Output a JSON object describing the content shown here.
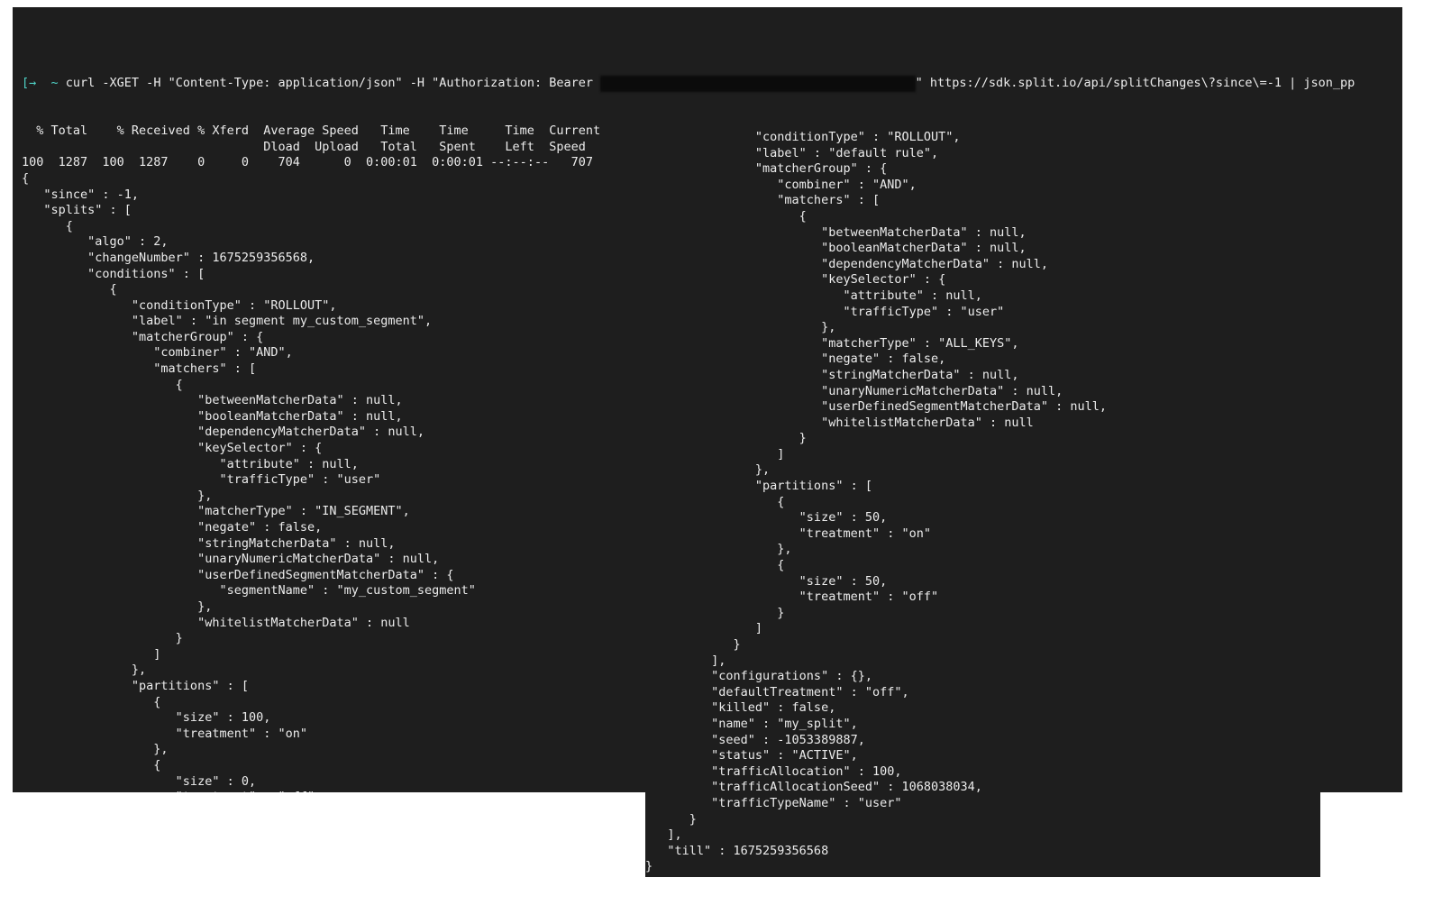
{
  "command": {
    "prompt_symbol": "[→  ~ ",
    "text_before_token": "curl -XGET -H \"Content-Type: application/json\" -H \"Authorization: Bearer ",
    "redacted_token": "                                           ",
    "text_after_token": "\" https://sdk.split.io/api/splitChanges\\?since\\=-1 | json_pp"
  },
  "left_lines": [
    "  % Total    % Received % Xferd  Average Speed   Time    Time     Time  Current",
    "                                 Dload  Upload   Total   Spent    Left  Speed",
    "100  1287  100  1287    0     0    704      0  0:00:01  0:00:01 --:--:--   707",
    "{",
    "   \"since\" : -1,",
    "   \"splits\" : [",
    "      {",
    "         \"algo\" : 2,",
    "         \"changeNumber\" : 1675259356568,",
    "         \"conditions\" : [",
    "            {",
    "               \"conditionType\" : \"ROLLOUT\",",
    "               \"label\" : \"in segment my_custom_segment\",",
    "               \"matcherGroup\" : {",
    "                  \"combiner\" : \"AND\",",
    "                  \"matchers\" : [",
    "                     {",
    "                        \"betweenMatcherData\" : null,",
    "                        \"booleanMatcherData\" : null,",
    "                        \"dependencyMatcherData\" : null,",
    "                        \"keySelector\" : {",
    "                           \"attribute\" : null,",
    "                           \"trafficType\" : \"user\"",
    "                        },",
    "                        \"matcherType\" : \"IN_SEGMENT\",",
    "                        \"negate\" : false,",
    "                        \"stringMatcherData\" : null,",
    "                        \"unaryNumericMatcherData\" : null,",
    "                        \"userDefinedSegmentMatcherData\" : {",
    "                           \"segmentName\" : \"my_custom_segment\"",
    "                        },",
    "                        \"whitelistMatcherData\" : null",
    "                     }",
    "                  ]",
    "               },",
    "               \"partitions\" : [",
    "                  {",
    "                     \"size\" : 100,",
    "                     \"treatment\" : \"on\"",
    "                  },",
    "                  {",
    "                     \"size\" : 0,",
    "                     \"treatment\" : \"off\"",
    "                  }",
    "               ]",
    "            },",
    "            {",
    "               \"conditionType\" : \"ROLLOUT\","
  ],
  "right_lines": [
    "               \"conditionType\" : \"ROLLOUT\",",
    "               \"label\" : \"default rule\",",
    "               \"matcherGroup\" : {",
    "                  \"combiner\" : \"AND\",",
    "                  \"matchers\" : [",
    "                     {",
    "                        \"betweenMatcherData\" : null,",
    "                        \"booleanMatcherData\" : null,",
    "                        \"dependencyMatcherData\" : null,",
    "                        \"keySelector\" : {",
    "                           \"attribute\" : null,",
    "                           \"trafficType\" : \"user\"",
    "                        },",
    "                        \"matcherType\" : \"ALL_KEYS\",",
    "                        \"negate\" : false,",
    "                        \"stringMatcherData\" : null,",
    "                        \"unaryNumericMatcherData\" : null,",
    "                        \"userDefinedSegmentMatcherData\" : null,",
    "                        \"whitelistMatcherData\" : null",
    "                     }",
    "                  ]",
    "               },",
    "               \"partitions\" : [",
    "                  {",
    "                     \"size\" : 50,",
    "                     \"treatment\" : \"on\"",
    "                  },",
    "                  {",
    "                     \"size\" : 50,",
    "                     \"treatment\" : \"off\"",
    "                  }",
    "               ]",
    "            }",
    "         ],",
    "         \"configurations\" : {},",
    "         \"defaultTreatment\" : \"off\",",
    "         \"killed\" : false,",
    "         \"name\" : \"my_split\",",
    "         \"seed\" : -1053389887,",
    "         \"status\" : \"ACTIVE\",",
    "         \"trafficAllocation\" : 100,",
    "         \"trafficAllocationSeed\" : 1068038034,",
    "         \"trafficTypeName\" : \"user\"",
    "      }",
    "   ],",
    "   \"till\" : 1675259356568",
    "}"
  ]
}
